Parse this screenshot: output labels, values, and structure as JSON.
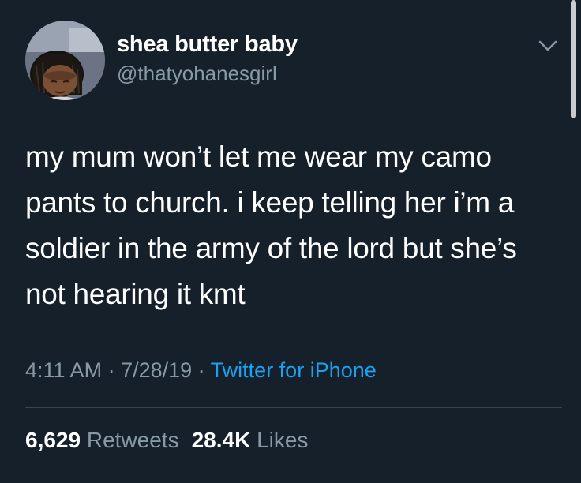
{
  "user": {
    "display_name": "shea butter baby",
    "handle": "@thatyohanesgirl"
  },
  "tweet": {
    "lines": [
      "my mum won’t let me wear my camo",
      "pants to church. i keep telling her i’m a",
      "soldier in the army of the lord but she’s",
      "not hearing it kmt"
    ],
    "time": "4:11 AM",
    "separator": " · ",
    "date": "7/28/19",
    "source": "Twitter for iPhone"
  },
  "stats": {
    "retweets_count": "6,629",
    "retweets_label": "Retweets",
    "likes_count": "28.4K",
    "likes_label": "Likes"
  },
  "colors": {
    "background": "#15202b",
    "text": "#ffffff",
    "secondary": "#8899a6",
    "accent": "#1da1f2",
    "divider": "#38444d"
  },
  "icons": {
    "menu": "chevron-down-icon"
  }
}
